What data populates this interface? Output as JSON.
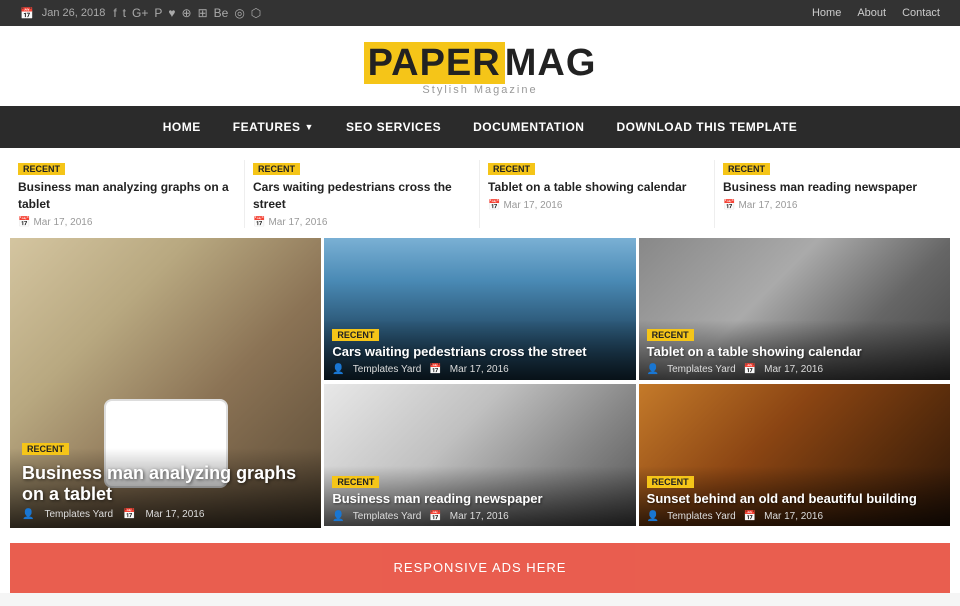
{
  "topbar": {
    "date": "Jan 26, 2018",
    "nav": {
      "home": "Home",
      "about": "About",
      "contact": "Contact"
    },
    "social_icons": [
      "f",
      "t",
      "g+",
      "p",
      "♥",
      "◉",
      "r",
      "Be",
      "☉",
      "⬡"
    ]
  },
  "header": {
    "title_part1": "PAPER",
    "title_part2": "MAG",
    "tagline": "Stylish Magazine"
  },
  "nav": {
    "items": [
      {
        "label": "HOME",
        "has_arrow": false
      },
      {
        "label": "FEATURES",
        "has_arrow": true
      },
      {
        "label": "SEO SERVICES",
        "has_arrow": false
      },
      {
        "label": "DOCUMENTATION",
        "has_arrow": false
      },
      {
        "label": "DOWNLOAD THIS TEMPLATE",
        "has_arrow": false
      }
    ]
  },
  "teasers": [
    {
      "badge": "RECENT",
      "title": "Business man analyzing graphs on a tablet",
      "date": "Mar 17, 2016"
    },
    {
      "badge": "RECENT",
      "title": "Cars waiting pedestrians cross the street",
      "date": "Mar 17, 2016"
    },
    {
      "badge": "RECENT",
      "title": "Tablet on a table showing calendar",
      "date": "Mar 17, 2016"
    },
    {
      "badge": "RECENT",
      "title": "Business man reading newspaper",
      "date": "Mar 17, 2016"
    }
  ],
  "featured": {
    "main": {
      "badge": "RECENT",
      "title": "Business man analyzing graphs on a tablet",
      "author": "Templates Yard",
      "date": "Mar 17, 2016"
    },
    "cards": [
      {
        "badge": "RECENT",
        "title": "Cars waiting pedestrians cross the street",
        "author": "Templates Yard",
        "date": "Mar 17, 2016"
      },
      {
        "badge": "RECENT",
        "title": "Tablet on a table showing calendar",
        "author": "Templates Yard",
        "date": "Mar 17, 2016"
      },
      {
        "badge": "RECENT",
        "title": "Business man reading newspaper",
        "author": "Templates Yard",
        "date": "Mar 17, 2016"
      },
      {
        "badge": "RECENT",
        "title": "Sunset behind an old and beautiful building",
        "author": "Templates Yard",
        "date": "Mar 17, 2016"
      }
    ]
  },
  "ad_banner": {
    "text": "RESPONSIVE ADS HERE"
  }
}
